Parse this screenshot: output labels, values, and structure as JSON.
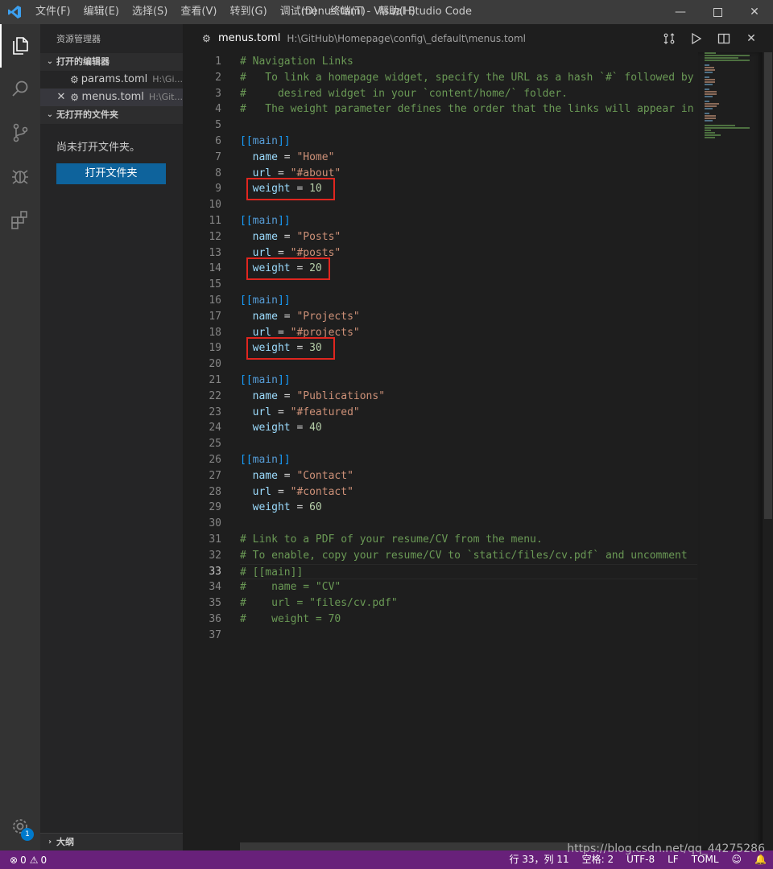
{
  "titlebar": {
    "menu": [
      "文件(F)",
      "编辑(E)",
      "选择(S)",
      "查看(V)",
      "转到(G)",
      "调试(D)",
      "终端(T)",
      "帮助(H)"
    ],
    "window_title": "menus.toml - Visual Studio Code",
    "controls": [
      "minimize",
      "maximize",
      "close"
    ]
  },
  "activitybar": {
    "icons": [
      "explorer-icon",
      "search-icon",
      "source-control-icon",
      "debug-icon",
      "extensions-icon"
    ],
    "settings_badge": "1"
  },
  "sidebar": {
    "title": "资源管理器",
    "open_editors_header": "打开的编辑器",
    "open_editors": [
      {
        "name": "params.toml",
        "path": "H:\\Gi..."
      },
      {
        "name": "menus.toml",
        "path": "H:\\Git..."
      }
    ],
    "no_folder_header": "无打开的文件夹",
    "no_folder_text": "尚未打开文件夹。",
    "open_folder_button": "打开文件夹",
    "outline_header": "大纲"
  },
  "tab": {
    "title": "menus.toml",
    "path": "H:\\GitHub\\Homepage\\config\\_default\\menus.toml"
  },
  "editor": {
    "line_numbers": [
      "1",
      "2",
      "3",
      "4",
      "5",
      "6",
      "7",
      "8",
      "9",
      "10",
      "11",
      "12",
      "13",
      "14",
      "15",
      "16",
      "17",
      "18",
      "19",
      "20",
      "21",
      "22",
      "23",
      "24",
      "25",
      "26",
      "27",
      "28",
      "29",
      "30",
      "31",
      "32",
      "33",
      "34",
      "35",
      "36",
      "37"
    ],
    "lines": [
      "# Navigation Links",
      "#   To link a homepage widget, specify the URL as a hash `#` followed by",
      "#     desired widget in your `content/home/` folder.",
      "#   The weight parameter defines the order that the links will appear in",
      "",
      "[[main]]",
      "  name = \"Home\"",
      "  url = \"#about\"",
      "  weight = 10",
      "",
      "[[main]]",
      "  name = \"Posts\"",
      "  url = \"#posts\"",
      "  weight = 20",
      "",
      "[[main]]",
      "  name = \"Projects\"",
      "  url = \"#projects\"",
      "  weight = 30",
      "",
      "[[main]]",
      "  name = \"Publications\"",
      "  url = \"#featured\"",
      "  weight = 40",
      "",
      "[[main]]",
      "  name = \"Contact\"",
      "  url = \"#contact\"",
      "  weight = 60",
      "",
      "# Link to a PDF of your resume/CV from the menu.",
      "# To enable, copy your resume/CV to `static/files/cv.pdf` and uncomment",
      "# [[main]]",
      "#    name = \"CV\"",
      "#    url = \"files/cv.pdf\"",
      "#    weight = 70",
      ""
    ],
    "highlighted_lines": [
      9,
      14,
      19
    ],
    "current_line": 33
  },
  "statusbar": {
    "errors": "0",
    "warnings": "0",
    "position": "行 33，列 11",
    "indent": "空格: 2",
    "encoding": "UTF-8",
    "eol": "LF",
    "language": "TOML"
  },
  "watermark": "https://blog.csdn.net/qq_44275286",
  "colors": {
    "statusbar": "#68217a",
    "button": "#0e639c",
    "highlight_box": "#e0261f",
    "comment": "#6a9955",
    "string": "#ce9178",
    "number": "#b5cea8",
    "key": "#9cdcfe"
  }
}
